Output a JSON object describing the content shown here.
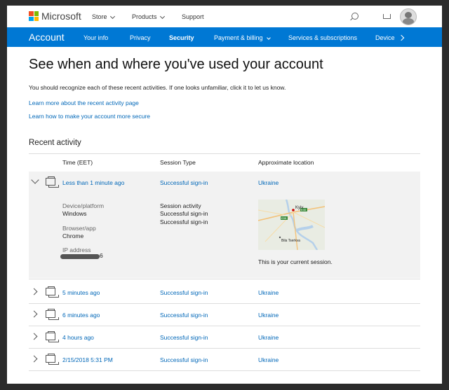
{
  "header": {
    "brand": "Microsoft",
    "nav": [
      {
        "label": "Store",
        "has_dropdown": true
      },
      {
        "label": "Products",
        "has_dropdown": true
      },
      {
        "label": "Support",
        "has_dropdown": false
      }
    ],
    "icons": [
      "search-icon",
      "cart-icon",
      "avatar"
    ]
  },
  "account_nav": {
    "title": "Account",
    "items": [
      "Your info",
      "Privacy",
      "Security",
      "Payment & billing",
      "Services & subscriptions",
      "Devices"
    ],
    "selected": "Security",
    "accent_color": "#0078d4"
  },
  "page": {
    "title": "See when and where you've used your account",
    "intro": "You should recognize each of these recent activities. If one looks unfamiliar, click it to let us know.",
    "links": [
      "Learn more about the recent activity page",
      "Learn how to make your account more secure"
    ]
  },
  "recent": {
    "heading": "Recent activity",
    "columns": [
      "Time (EET)",
      "Session Type",
      "Approximate location"
    ],
    "rows": [
      {
        "time": "Less than 1 minute ago",
        "type": "Successful sign-in",
        "location": "Ukraine"
      },
      {
        "time": "5 minutes ago",
        "type": "Successful sign-in",
        "location": "Ukraine"
      },
      {
        "time": "6 minutes ago",
        "type": "Successful sign-in",
        "location": "Ukraine"
      },
      {
        "time": "4 hours ago",
        "type": "Successful sign-in",
        "location": "Ukraine"
      },
      {
        "time": "2/15/2018 5:31 PM",
        "type": "Successful sign-in",
        "location": "Ukraine"
      }
    ],
    "detail": {
      "device_label": "Device/platform",
      "device_value": "Windows",
      "browser_label": "Browser/app",
      "browser_value": "Chrome",
      "ip_label": "IP address",
      "ip_tail": "6",
      "activity_label": "Session activity",
      "activity_values": [
        "Successful sign-in",
        "Successful sign-in"
      ],
      "map_labels": {
        "city1": "Kyiv",
        "city2": "Bila Tserkva",
        "road1": "E95",
        "road2": "E40"
      },
      "current_session": "This is your current session."
    }
  }
}
